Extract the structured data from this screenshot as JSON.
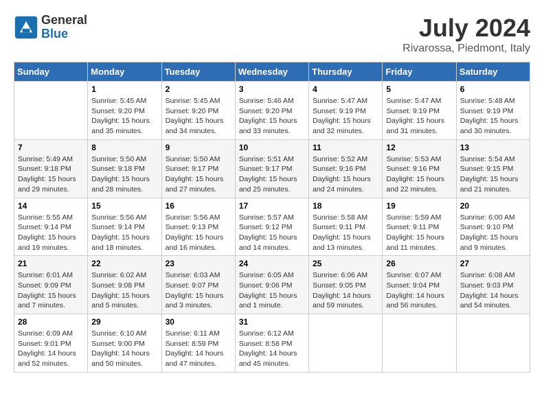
{
  "logo": {
    "general": "General",
    "blue": "Blue"
  },
  "title": {
    "month_year": "July 2024",
    "location": "Rivarossa, Piedmont, Italy"
  },
  "days_header": [
    "Sunday",
    "Monday",
    "Tuesday",
    "Wednesday",
    "Thursday",
    "Friday",
    "Saturday"
  ],
  "weeks": [
    [
      {
        "day": "",
        "info": ""
      },
      {
        "day": "1",
        "info": "Sunrise: 5:45 AM\nSunset: 9:20 PM\nDaylight: 15 hours\nand 35 minutes."
      },
      {
        "day": "2",
        "info": "Sunrise: 5:45 AM\nSunset: 9:20 PM\nDaylight: 15 hours\nand 34 minutes."
      },
      {
        "day": "3",
        "info": "Sunrise: 5:46 AM\nSunset: 9:20 PM\nDaylight: 15 hours\nand 33 minutes."
      },
      {
        "day": "4",
        "info": "Sunrise: 5:47 AM\nSunset: 9:19 PM\nDaylight: 15 hours\nand 32 minutes."
      },
      {
        "day": "5",
        "info": "Sunrise: 5:47 AM\nSunset: 9:19 PM\nDaylight: 15 hours\nand 31 minutes."
      },
      {
        "day": "6",
        "info": "Sunrise: 5:48 AM\nSunset: 9:19 PM\nDaylight: 15 hours\nand 30 minutes."
      }
    ],
    [
      {
        "day": "7",
        "info": "Sunrise: 5:49 AM\nSunset: 9:18 PM\nDaylight: 15 hours\nand 29 minutes."
      },
      {
        "day": "8",
        "info": "Sunrise: 5:50 AM\nSunset: 9:18 PM\nDaylight: 15 hours\nand 28 minutes."
      },
      {
        "day": "9",
        "info": "Sunrise: 5:50 AM\nSunset: 9:17 PM\nDaylight: 15 hours\nand 27 minutes."
      },
      {
        "day": "10",
        "info": "Sunrise: 5:51 AM\nSunset: 9:17 PM\nDaylight: 15 hours\nand 25 minutes."
      },
      {
        "day": "11",
        "info": "Sunrise: 5:52 AM\nSunset: 9:16 PM\nDaylight: 15 hours\nand 24 minutes."
      },
      {
        "day": "12",
        "info": "Sunrise: 5:53 AM\nSunset: 9:16 PM\nDaylight: 15 hours\nand 22 minutes."
      },
      {
        "day": "13",
        "info": "Sunrise: 5:54 AM\nSunset: 9:15 PM\nDaylight: 15 hours\nand 21 minutes."
      }
    ],
    [
      {
        "day": "14",
        "info": "Sunrise: 5:55 AM\nSunset: 9:14 PM\nDaylight: 15 hours\nand 19 minutes."
      },
      {
        "day": "15",
        "info": "Sunrise: 5:56 AM\nSunset: 9:14 PM\nDaylight: 15 hours\nand 18 minutes."
      },
      {
        "day": "16",
        "info": "Sunrise: 5:56 AM\nSunset: 9:13 PM\nDaylight: 15 hours\nand 16 minutes."
      },
      {
        "day": "17",
        "info": "Sunrise: 5:57 AM\nSunset: 9:12 PM\nDaylight: 15 hours\nand 14 minutes."
      },
      {
        "day": "18",
        "info": "Sunrise: 5:58 AM\nSunset: 9:11 PM\nDaylight: 15 hours\nand 13 minutes."
      },
      {
        "day": "19",
        "info": "Sunrise: 5:59 AM\nSunset: 9:11 PM\nDaylight: 15 hours\nand 11 minutes."
      },
      {
        "day": "20",
        "info": "Sunrise: 6:00 AM\nSunset: 9:10 PM\nDaylight: 15 hours\nand 9 minutes."
      }
    ],
    [
      {
        "day": "21",
        "info": "Sunrise: 6:01 AM\nSunset: 9:09 PM\nDaylight: 15 hours\nand 7 minutes."
      },
      {
        "day": "22",
        "info": "Sunrise: 6:02 AM\nSunset: 9:08 PM\nDaylight: 15 hours\nand 5 minutes."
      },
      {
        "day": "23",
        "info": "Sunrise: 6:03 AM\nSunset: 9:07 PM\nDaylight: 15 hours\nand 3 minutes."
      },
      {
        "day": "24",
        "info": "Sunrise: 6:05 AM\nSunset: 9:06 PM\nDaylight: 15 hours\nand 1 minute."
      },
      {
        "day": "25",
        "info": "Sunrise: 6:06 AM\nSunset: 9:05 PM\nDaylight: 14 hours\nand 59 minutes."
      },
      {
        "day": "26",
        "info": "Sunrise: 6:07 AM\nSunset: 9:04 PM\nDaylight: 14 hours\nand 56 minutes."
      },
      {
        "day": "27",
        "info": "Sunrise: 6:08 AM\nSunset: 9:03 PM\nDaylight: 14 hours\nand 54 minutes."
      }
    ],
    [
      {
        "day": "28",
        "info": "Sunrise: 6:09 AM\nSunset: 9:01 PM\nDaylight: 14 hours\nand 52 minutes."
      },
      {
        "day": "29",
        "info": "Sunrise: 6:10 AM\nSunset: 9:00 PM\nDaylight: 14 hours\nand 50 minutes."
      },
      {
        "day": "30",
        "info": "Sunrise: 6:11 AM\nSunset: 8:59 PM\nDaylight: 14 hours\nand 47 minutes."
      },
      {
        "day": "31",
        "info": "Sunrise: 6:12 AM\nSunset: 8:58 PM\nDaylight: 14 hours\nand 45 minutes."
      },
      {
        "day": "",
        "info": ""
      },
      {
        "day": "",
        "info": ""
      },
      {
        "day": "",
        "info": ""
      }
    ]
  ]
}
